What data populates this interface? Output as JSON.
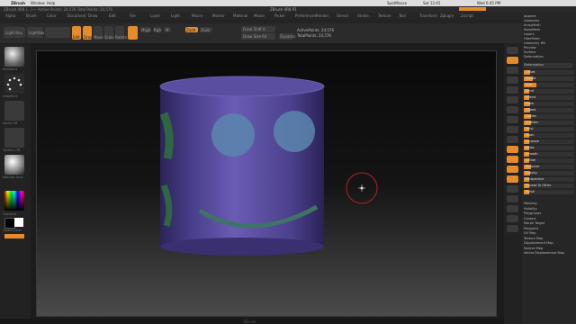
{
  "macbar": {
    "app": "ZBrush",
    "window": "Window",
    "help": "Help",
    "right_items": [
      "SpotMouse",
      "Sat 12:45",
      "Wed 6:45 PM"
    ]
  },
  "title": {
    "text": "ZBrush 4R8 [...] — Active Points: 24,576  Total Points: 24,576",
    "center": "ZBrush 4R8 P1"
  },
  "menus": [
    "Alpha",
    "Brush",
    "Color",
    "Document",
    "Draw",
    "Edit",
    "File",
    "Layer",
    "Light",
    "Macro",
    "Marker",
    "Material",
    "Movie",
    "Picker",
    "Preferences",
    "Render",
    "Stencil",
    "Stroke",
    "Texture",
    "Tool",
    "Transform",
    "Zplugin",
    "Zscript"
  ],
  "toolbar": {
    "light_box": "Light Box",
    "lightbox_brush": "LightBox Brushes",
    "edit": "Edit",
    "draw": "Draw",
    "move": "Move",
    "scale": "Scale",
    "rotate": "Rotate",
    "mrgb": "Mrgb",
    "rgb": "Rgb",
    "m": "M",
    "zadd": "Zadd",
    "zsub": "Zsub",
    "focal_shift": "Focal Shift 0",
    "draw_size": "Draw Size 64",
    "dynamic": "Dynamic",
    "active_points": "ActivePoints: 24,576",
    "total_points": "TotalPoints: 24,576"
  },
  "left_shelf": {
    "labels": [
      "Standard",
      "DragRect",
      "Alpha Off",
      "Texture Off",
      "MatCap Gray",
      "Gradient",
      "SwitchColor",
      "Alternate"
    ],
    "colors": {
      "primary": "#ffffff",
      "secondary": "#000000"
    }
  },
  "right_shelf": [
    "BPR",
    "SPix 3",
    "Scroll",
    "Zoom",
    "Actual",
    "AAHalf",
    "Persp",
    "Floor",
    "Local",
    "LSym",
    "Frame",
    "Move",
    "Scale",
    "Rotate",
    "PolyF",
    "Transp",
    "Ghost",
    "Solo",
    "Xpose"
  ],
  "tray": {
    "top_items": [
      "Append",
      "Geometry",
      "ArrayMesh",
      "NanoMesh",
      "Layers",
      "FiberMesh",
      "Geometry HD",
      "Preview",
      "Surface",
      "Deformation"
    ],
    "section": "Deformation",
    "sliders": [
      {
        "label": "Offset",
        "value": 0.12
      },
      {
        "label": "Rotate",
        "value": 0.18
      },
      {
        "label": "Size",
        "value": 0.25
      },
      {
        "label": "Bend",
        "value": 0.1
      },
      {
        "label": "SBend",
        "value": 0.1
      },
      {
        "label": "Skew",
        "value": 0.12
      },
      {
        "label": "SSkew",
        "value": 0.12
      },
      {
        "label": "Flatten",
        "value": 0.15
      },
      {
        "label": "SFlatten",
        "value": 0.15
      },
      {
        "label": "Twist",
        "value": 0.1
      },
      {
        "label": "Taper",
        "value": 0.1
      },
      {
        "label": "Squeeze",
        "value": 0.1
      },
      {
        "label": "Noise",
        "value": 0.1
      },
      {
        "label": "Smooth",
        "value": 0.1
      },
      {
        "label": "Inflate",
        "value": 0.1
      },
      {
        "label": "Spherize",
        "value": 0.15
      },
      {
        "label": "Gravity",
        "value": 0.12
      },
      {
        "label": "Perspective",
        "value": 0.1
      },
      {
        "label": "Repeat To Other",
        "value": 0.1
      },
      {
        "label": "Polish",
        "value": 0.1
      }
    ],
    "bottom_items": [
      "Masking",
      "Visibility",
      "Polygroups",
      "Contact",
      "Morph Target",
      "Polypaint",
      "UV Map",
      "Texture Map",
      "Displacement Map",
      "Normal Map",
      "Vector Displacement Map"
    ]
  },
  "status": {
    "text": "ZBrush"
  },
  "colors": {
    "accent": "#e48b2c",
    "mesh": "#5d4fa0",
    "mesh_dark": "#3d3270",
    "eyes": "#5f8cb0",
    "green": "#3f7a4f"
  }
}
